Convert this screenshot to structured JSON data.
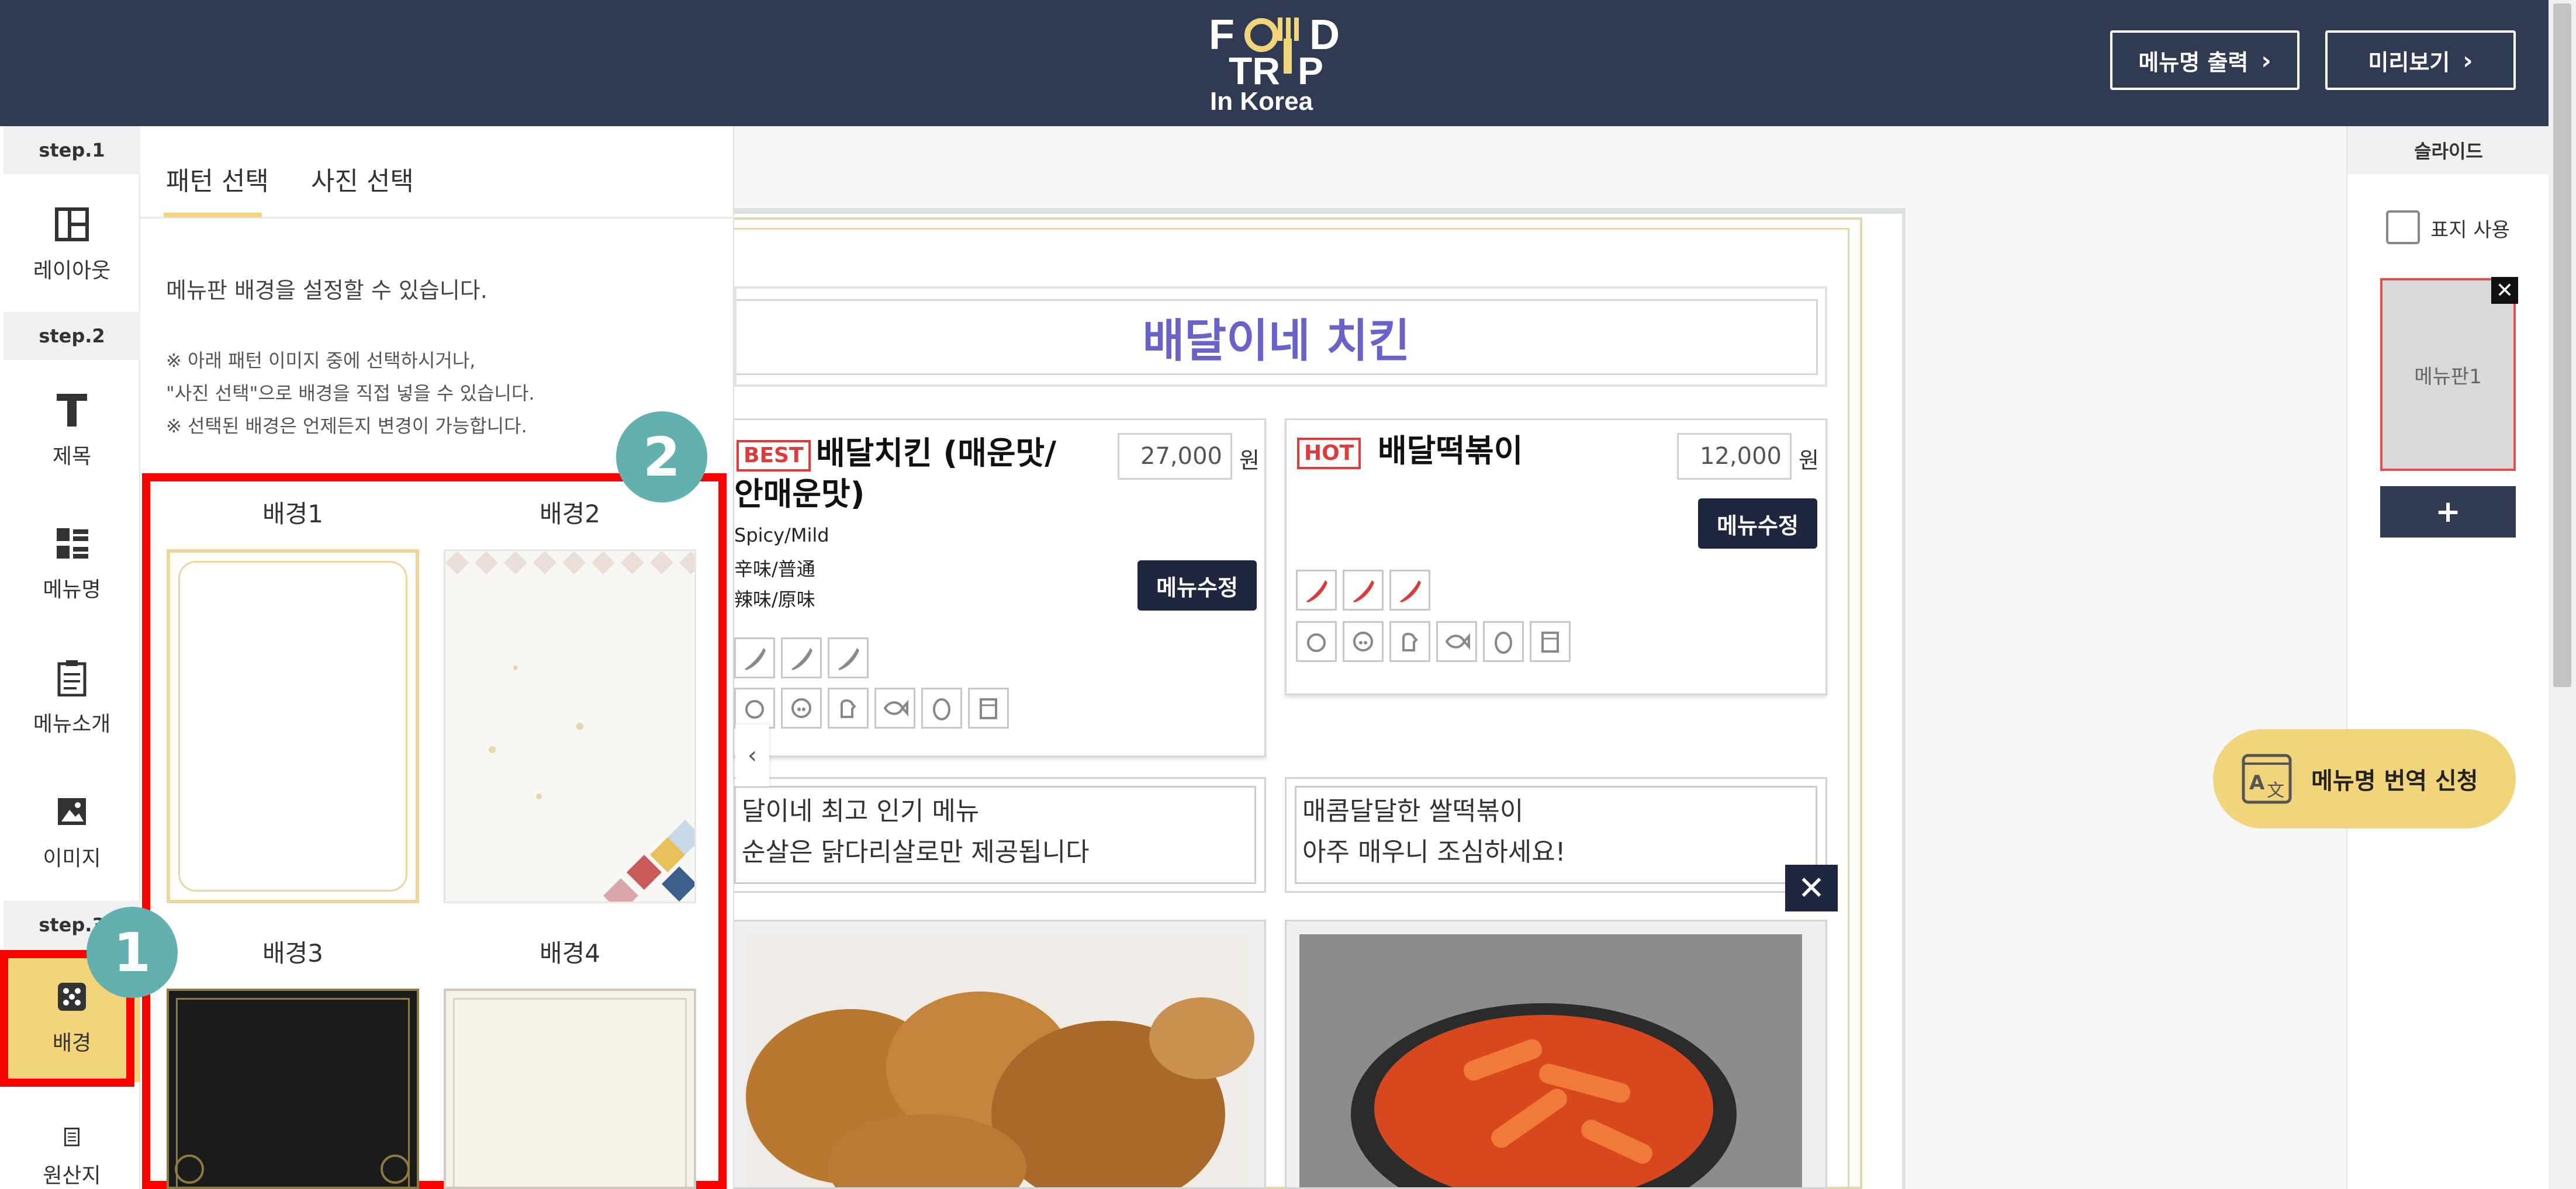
{
  "header": {
    "logo_text": "FOOD TRIP In Korea",
    "export_label": "메뉴명 출력",
    "preview_label": "미리보기"
  },
  "sidebar": {
    "steps": [
      {
        "label": "step.1"
      },
      {
        "label": "step.2"
      },
      {
        "label": "step.3"
      }
    ],
    "items": [
      {
        "label": "레이아웃",
        "icon": "layout-icon"
      },
      {
        "label": "제목",
        "icon": "text-t-icon"
      },
      {
        "label": "메뉴명",
        "icon": "menu-list-icon"
      },
      {
        "label": "메뉴소개",
        "icon": "clipboard-icon"
      },
      {
        "label": "이미지",
        "icon": "image-icon"
      },
      {
        "label": "배경",
        "icon": "dice-icon",
        "active": true
      },
      {
        "label": "원산지",
        "icon": "document-icon"
      }
    ]
  },
  "panel": {
    "tabs": [
      {
        "label": "패턴 선택",
        "active": true
      },
      {
        "label": "사진 선택",
        "active": false
      }
    ],
    "description": "메뉴판 배경을 설정할 수 있습니다.",
    "notes": [
      "※ 아래 패턴 이미지 중에 선택하시거나,",
      "\"사진 선택\"으로 배경을 직접 넣을 수 있습니다.",
      "※ 선택된 배경은 언제든지 변경이 가능합니다."
    ],
    "backgrounds": [
      {
        "title": "배경1"
      },
      {
        "title": "배경2"
      },
      {
        "title": "배경3"
      },
      {
        "title": "배경4"
      }
    ]
  },
  "menu_board": {
    "title": "배달이네 치킨",
    "items": [
      {
        "badge": "BEST",
        "name_line1": "배달치킨 (매운맛/",
        "name_line2": "안매운맛)",
        "price": "27,000",
        "currency": "원",
        "sub_lines": [
          "Spicy/Mild",
          "辛味/普通",
          "辣味/原味"
        ],
        "edit_label": "메뉴수정",
        "description_line1": "달이네 최고 인기 메뉴",
        "description_line2": "순살은 닭다리살로만 제공됩니다"
      },
      {
        "badge": "HOT",
        "name_line1": "배달떡볶이",
        "price": "12,000",
        "currency": "원",
        "edit_label": "메뉴수정",
        "description_line1": "매콤달달한 쌀떡볶이",
        "description_line2": "아주 매우니 조심하세요!"
      }
    ],
    "close_symbol": "✕",
    "prev_symbol": "‹"
  },
  "right_panel": {
    "header": "슬라이드",
    "cover_label": "표지 사용",
    "slide_label": "메뉴판1",
    "close_symbol": "✕",
    "add_symbol": "+"
  },
  "translate_button": {
    "label": "메뉴명 번역 신청"
  },
  "annotations": {
    "marker1": "1",
    "marker2": "2"
  },
  "colors": {
    "header_bg": "#2f3a53",
    "accent_yellow": "#f2d47a",
    "highlight_red": "#ff0000",
    "annotation_teal": "#63b1ae",
    "title_purple": "#6a62c9",
    "badge_red": "#e03b3b"
  }
}
